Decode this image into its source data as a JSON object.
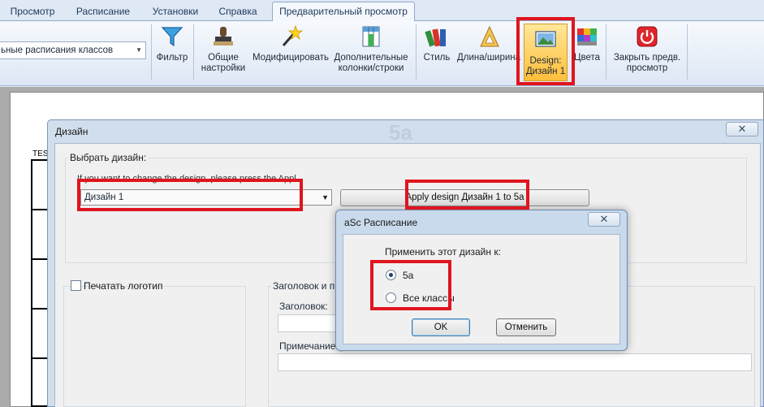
{
  "ribbon": {
    "tabs": [
      {
        "label": "Просмотр",
        "active": false
      },
      {
        "label": "Расписание",
        "active": false
      },
      {
        "label": "Установки",
        "active": false
      },
      {
        "label": "Справка",
        "active": false
      },
      {
        "label": "Предварительный просмотр",
        "active": true
      }
    ],
    "class_combo_value": "ьные расписания классов",
    "buttons": [
      {
        "label": "Фильтр",
        "icon": "funnel-icon"
      },
      {
        "label": "Общие настройки",
        "icon": "stamp-icon"
      },
      {
        "label": "Модифицировать",
        "icon": "magic-wand-icon"
      },
      {
        "label": "Дополнительные колонки/строки",
        "icon": "insert-columns-icon"
      },
      {
        "label": "Стиль",
        "icon": "books-icon"
      },
      {
        "label": "Длина/ширина",
        "icon": "ruler-triangle-icon"
      },
      {
        "label": "Design: Дизайн 1",
        "icon": "design-picture-icon",
        "highlighted": true
      },
      {
        "label": "Цвета",
        "icon": "color-palette-icon"
      },
      {
        "label": "Закрыть предв. просмотр",
        "icon": "power-icon"
      }
    ]
  },
  "background_page": {
    "label": "TES"
  },
  "design_dialog": {
    "title": "Дизайн",
    "watermark": "5a",
    "choose_group_label": "Выбрать дизайн:",
    "hint": "If you want to change the design, please press the Appl",
    "selected_design": "Дизайн 1",
    "apply_button": "Apply design Дизайн 1 to 5a",
    "print_logo_label": "Печатать логотип",
    "header_group_label": "Заголовок и при",
    "header_label": "Заголовок:",
    "note_label": "Примечание (о"
  },
  "asc_modal": {
    "title": "aSc Расписание",
    "prompt": "Применить этот дизайн к:",
    "options": [
      {
        "label": "5a",
        "selected": true
      },
      {
        "label": "Все классы",
        "selected": false
      }
    ],
    "ok": "OK",
    "cancel": "Отменить"
  },
  "colors": {
    "highlight_red": "#e0141e",
    "ribbon_highlight": "#ffbe3a"
  }
}
